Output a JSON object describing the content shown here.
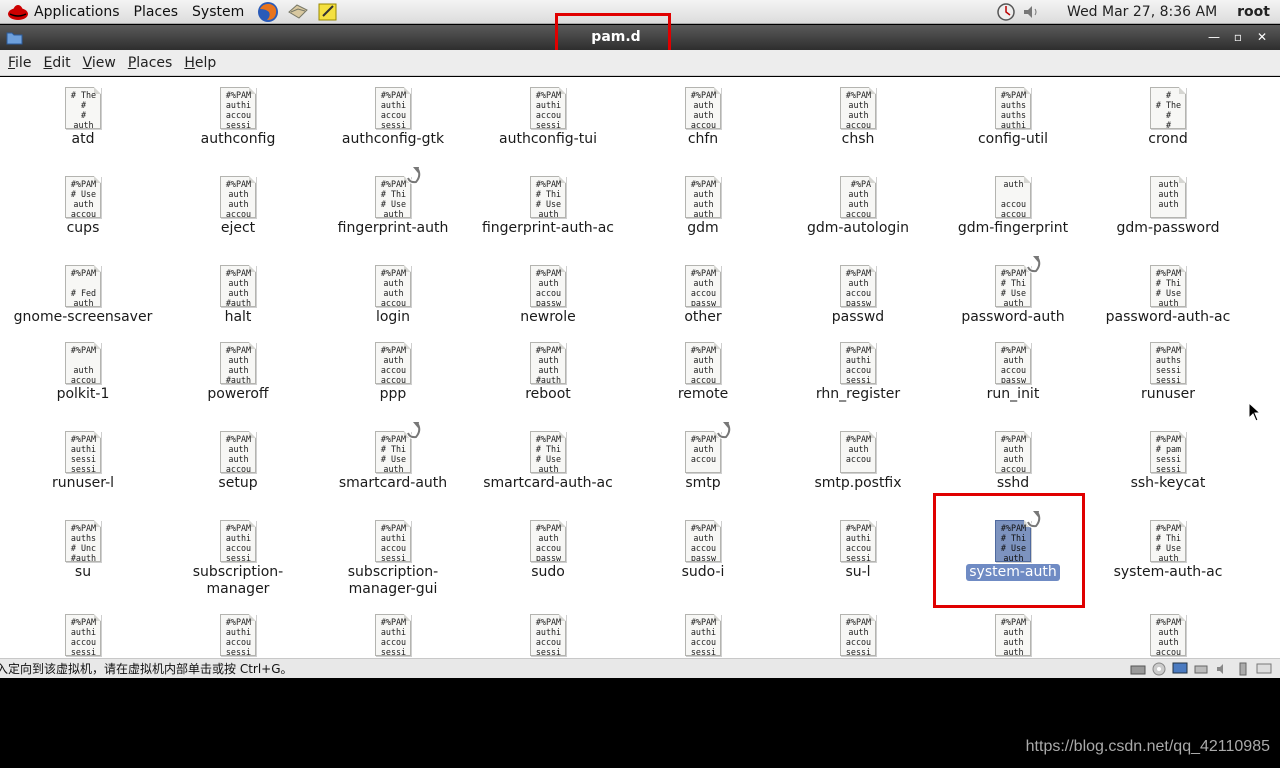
{
  "top_panel": {
    "menus": [
      "Applications",
      "Places",
      "System"
    ],
    "clock": "Wed Mar 27,  8:36 AM",
    "user": "root"
  },
  "window": {
    "title": "pam.d"
  },
  "menubar": {
    "items": [
      {
        "key": "F",
        "rest": "ile"
      },
      {
        "key": "E",
        "rest": "dit"
      },
      {
        "key": "V",
        "rest": "iew"
      },
      {
        "key": "P",
        "rest": "laces"
      },
      {
        "key": "H",
        "rest": "elp"
      }
    ]
  },
  "files": [
    {
      "name": "atd",
      "preview": "# The\n#\n#\nauth",
      "link": false
    },
    {
      "name": "authconfig",
      "preview": "#%PAM\nauthi\naccou\nsessi",
      "link": false
    },
    {
      "name": "authconfig-gtk",
      "preview": "#%PAM\nauthi\naccou\nsessi",
      "link": false
    },
    {
      "name": "authconfig-tui",
      "preview": "#%PAM\nauthi\naccou\nsessi",
      "link": false
    },
    {
      "name": "chfn",
      "preview": "#%PAM\nauth\nauth\naccou",
      "link": false
    },
    {
      "name": "chsh",
      "preview": "#%PAM\nauth\nauth\naccou",
      "link": false
    },
    {
      "name": "config-util",
      "preview": "#%PAM\nauths\nauths\nauthi",
      "link": false
    },
    {
      "name": "crond",
      "preview": "#\n# The\n#\n#",
      "link": false
    },
    {
      "name": "cups",
      "preview": "#%PAM\n# Use\nauth\naccou",
      "link": false
    },
    {
      "name": "eject",
      "preview": "#%PAM\nauth\nauth\naccou",
      "link": false
    },
    {
      "name": "fingerprint-auth",
      "preview": "#%PAM\n# Thi\n# Use\nauth",
      "link": true
    },
    {
      "name": "fingerprint-auth-ac",
      "preview": "#%PAM\n# Thi\n# Use\nauth",
      "link": false
    },
    {
      "name": "gdm",
      "preview": "#%PAM\nauth\nauth\nauth",
      "link": false
    },
    {
      "name": "gdm-autologin",
      "preview": " #%PA\nauth\nauth\naccou",
      "link": false
    },
    {
      "name": "gdm-fingerprint",
      "preview": "auth\n\naccou\naccou",
      "link": false
    },
    {
      "name": "gdm-password",
      "preview": "auth\nauth\nauth",
      "link": false
    },
    {
      "name": "gnome-screensaver",
      "preview": "#%PAM\n\n# Fed\nauth",
      "link": false
    },
    {
      "name": "halt",
      "preview": "#%PAM\nauth\nauth\n#auth",
      "link": false
    },
    {
      "name": "login",
      "preview": "#%PAM\nauth\nauth\naccou",
      "link": false
    },
    {
      "name": "newrole",
      "preview": "#%PAM\nauth\naccou\npassw",
      "link": false
    },
    {
      "name": "other",
      "preview": "#%PAM\nauth\naccou\npassw",
      "link": false
    },
    {
      "name": "passwd",
      "preview": "#%PAM\nauth\naccou\npassw",
      "link": false
    },
    {
      "name": "password-auth",
      "preview": "#%PAM\n# Thi\n# Use\nauth",
      "link": true
    },
    {
      "name": "password-auth-ac",
      "preview": "#%PAM\n# Thi\n# Use\nauth",
      "link": false
    },
    {
      "name": "polkit-1",
      "preview": "#%PAM\n\nauth\naccou",
      "link": false
    },
    {
      "name": "poweroff",
      "preview": "#%PAM\nauth\nauth\n#auth",
      "link": false
    },
    {
      "name": "ppp",
      "preview": "#%PAM\nauth\naccou\naccou",
      "link": false
    },
    {
      "name": "reboot",
      "preview": "#%PAM\nauth\nauth\n#auth",
      "link": false
    },
    {
      "name": "remote",
      "preview": "#%PAM\nauth\nauth\naccou",
      "link": false
    },
    {
      "name": "rhn_register",
      "preview": "#%PAM\nauthi\naccou\nsessi",
      "link": false
    },
    {
      "name": "run_init",
      "preview": "#%PAM\nauth\naccou\npassw",
      "link": false
    },
    {
      "name": "runuser",
      "preview": "#%PAM\nauths\nsessi\nsessi",
      "link": false
    },
    {
      "name": "runuser-l",
      "preview": "#%PAM\nauthi\nsessi\nsessi",
      "link": false
    },
    {
      "name": "setup",
      "preview": "#%PAM\nauth\nauth\naccou",
      "link": false
    },
    {
      "name": "smartcard-auth",
      "preview": "#%PAM\n# Thi\n# Use\nauth",
      "link": true
    },
    {
      "name": "smartcard-auth-ac",
      "preview": "#%PAM\n# Thi\n# Use\nauth",
      "link": false
    },
    {
      "name": "smtp",
      "preview": "#%PAM\nauth\naccou",
      "link": true
    },
    {
      "name": "smtp.postfix",
      "preview": "#%PAM\nauth\naccou",
      "link": false
    },
    {
      "name": "sshd",
      "preview": "#%PAM\nauth\nauth\naccou",
      "link": false
    },
    {
      "name": "ssh-keycat",
      "preview": "#%PAM\n# pam\nsessi\nsessi",
      "link": false
    },
    {
      "name": "su",
      "preview": "#%PAM\nauths\n# Unc\n#auth",
      "link": false
    },
    {
      "name": "subscription-\nmanager",
      "preview": "#%PAM\nauthi\naccou\nsessi",
      "link": false
    },
    {
      "name": "subscription-\nmanager-gui",
      "preview": "#%PAM\nauthi\naccou\nsessi",
      "link": false
    },
    {
      "name": "sudo",
      "preview": "#%PAM\nauth\naccou\npassw",
      "link": false
    },
    {
      "name": "sudo-i",
      "preview": "#%PAM\nauth\naccou\npassw",
      "link": false
    },
    {
      "name": "su-l",
      "preview": "#%PAM\nauthi\naccou\nsessi",
      "link": false
    },
    {
      "name": "system-auth",
      "preview": "#%PAM\n# Thi\n# Use\nauth",
      "link": true,
      "selected": true
    },
    {
      "name": "system-auth-ac",
      "preview": "#%PAM\n# Thi\n# Use\nauth",
      "link": false
    },
    {
      "name": "",
      "preview": "#%PAM\nauthi\naccou\nsessi",
      "link": false
    },
    {
      "name": "",
      "preview": "#%PAM\nauthi\naccou\nsessi",
      "link": false
    },
    {
      "name": "",
      "preview": "#%PAM\nauthi\naccou\nsessi",
      "link": false
    },
    {
      "name": "",
      "preview": "#%PAM\nauthi\naccou\nsessi",
      "link": false
    },
    {
      "name": "",
      "preview": "#%PAM\nauthi\naccou\nsessi",
      "link": false
    },
    {
      "name": "",
      "preview": "#%PAM\nauth\naccou\nsessi",
      "link": false
    },
    {
      "name": "",
      "preview": "#%PAM\nauth\nauth\nauth",
      "link": false
    },
    {
      "name": "",
      "preview": "#%PAM\nauth\nauth\naccou",
      "link": false
    }
  ],
  "status_bar": {
    "text": "入定向到该虚拟机，请在虚拟机内部单击或按 Ctrl+G。"
  },
  "watermark": "https://blog.csdn.net/qq_42110985",
  "colors": {
    "selection": "#6f8bc4",
    "highlight_box": "#e00000"
  }
}
